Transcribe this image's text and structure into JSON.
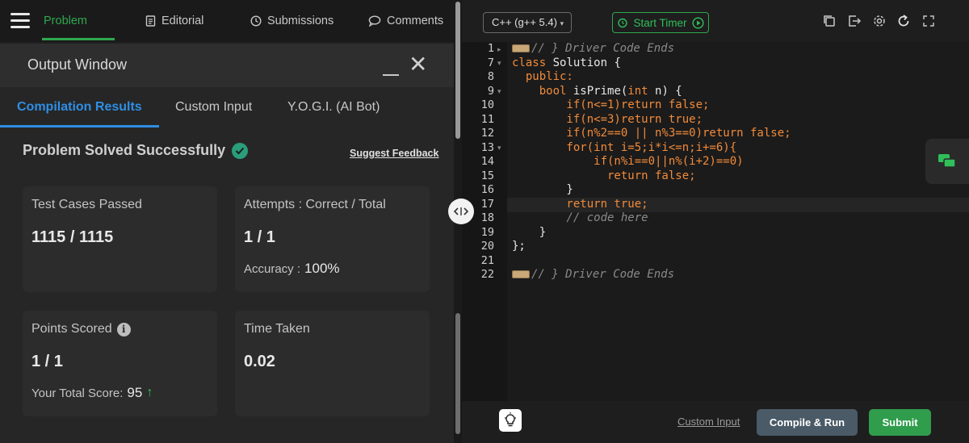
{
  "nav": {
    "tabs": [
      {
        "label": "Problem",
        "icon": "none"
      },
      {
        "label": "Editorial",
        "icon": "document-icon"
      },
      {
        "label": "Submissions",
        "icon": "clock-icon"
      },
      {
        "label": "Comments",
        "icon": "comment-icon"
      }
    ],
    "active_color": "#2fa84f"
  },
  "output": {
    "title": "Output Window",
    "tabs": [
      "Compilation Results",
      "Custom Input",
      "Y.O.G.I. (AI Bot)"
    ],
    "status": "Problem Solved Successfully",
    "suggest_feedback": "Suggest Feedback",
    "cards": {
      "tests": {
        "label": "Test Cases Passed",
        "value": "1115 / 1115"
      },
      "attempts": {
        "label": "Attempts : Correct / Total",
        "value": "1 / 1",
        "sub_label": "Accuracy :",
        "sub_value": "100%"
      },
      "points": {
        "label": "Points Scored",
        "value": "1 / 1",
        "sub_label": "Your Total Score:",
        "sub_value": "95"
      },
      "time": {
        "label": "Time Taken",
        "value": "0.02"
      }
    }
  },
  "editor": {
    "language": "C++ (g++ 5.4)",
    "timer_label": "Start Timer",
    "line_numbers": [
      "1",
      "7",
      "8",
      "9",
      "10",
      "11",
      "12",
      "13",
      "14",
      "15",
      "16",
      "17",
      "18",
      "19",
      "20",
      "21",
      "22"
    ],
    "code": {
      "l1": "// } Driver Code Ends",
      "l7a": "class",
      "l7b": " Solution {",
      "l8": "  public:",
      "l9a": "    bool",
      "l9b": " isPrime(",
      "l9c": "int",
      "l9d": " n) {",
      "l10": "        if(n<=1)return false;",
      "l11": "        if(n<=3)return true;",
      "l12": "        if(n%2==0 || n%3==0)return false;",
      "l13": "        for(int i=5;i*i<=n;i+=6){",
      "l14": "            if(n%i==0||n%(i+2)==0)",
      "l15": "              return false;",
      "l16": "        }",
      "l17": "        return true;",
      "l18": "        // code here",
      "l19": "    }",
      "l20": "};",
      "l22": "// } Driver Code Ends"
    },
    "custom_input": "Custom Input",
    "compile_label": "Compile & Run",
    "submit_label": "Submit"
  },
  "colors": {
    "accent_green": "#2fa84f",
    "accent_blue": "#2f8ee5",
    "keyword_orange": "#f28b3a"
  }
}
